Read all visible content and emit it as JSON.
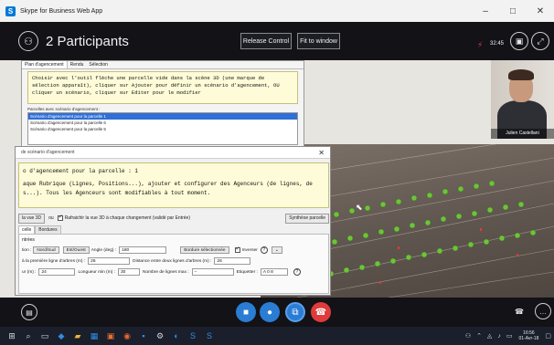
{
  "window": {
    "title": "Skype for Business Web App",
    "minimize": "–",
    "maximize": "□",
    "close": "✕"
  },
  "meeting": {
    "participants_label": "2 Participants",
    "release_control": "Release Control",
    "fit_to_window": "Fit to window",
    "elapsed": "32:45"
  },
  "video_tile": {
    "name": "Julien Castellani"
  },
  "scenario_panel": {
    "tabs": [
      "Plan d'agencement",
      "Rendu",
      "Sélection"
    ],
    "instructions": "Choisir avec l'outil flèche une parcelle vide dans la scène 3D (une marque de sélection apparaît), cliquer sur Ajouter pour définir un scénario d'agencement, OU cliquer un scénario, cliquer sur Editer pour le modifier",
    "list_label": "Parcelles avec scénario d'agencement :",
    "items": [
      "Scénario d'agencement pour la parcelle 1",
      "Scénario d'agencement pour la parcelle 6",
      "Scénario d'agencement pour la parcelle 5"
    ]
  },
  "dialog": {
    "title": "de scénario d'agencement",
    "heading": "o d'agencement pour la parcelle : 1",
    "body": "aque Rubrique (Lignes, Positions...), ajouter et configurer des Agenceurs (de lignes, de s...). Tous les Agenceurs sont modifiables à tout moment.",
    "view_3d_button": "la vue 3D",
    "or_label": "ou",
    "refresh_label": "Rafraichir la vue 3D à chaque changement (validé par Entrée)",
    "synthesis_button": "Synthèse parcelle",
    "tabs": [
      "celle",
      "Bordures"
    ],
    "section": "ntrées",
    "row1": {
      "label": "tion :",
      "ns_button": "Nord/Sud",
      "eo_button": "Est/Ouest",
      "angle_label": "Angle (deg) :",
      "angle_value": "180",
      "border_button": "Bordure sélectionnée",
      "invert_label": "Inverser"
    },
    "row2": {
      "first_line_label": "à la première ligne d'arbres (m) :",
      "first_line_value": "26",
      "distance_label": "Distance entre deux lignes d'arbres (m) :",
      "distance_value": "26"
    },
    "row3": {
      "width_label": "ur (m) :",
      "width_value": "24",
      "min_length_label": "Longueur min (m) :",
      "min_length_value": "30",
      "max_lines_label": "Nombre de lignes max :",
      "max_lines_value": "–",
      "label_label": "Etiquetter :",
      "label_value": "A 0 8"
    }
  },
  "taskbar": {
    "clock_time": "16:56",
    "clock_date": "01-Avr-18"
  },
  "colors": {
    "selection": "#2f6fd6",
    "hangup": "#e03b3b",
    "call_controls": "#2b7cd3",
    "instructions_bg": "#fdfbd8"
  }
}
